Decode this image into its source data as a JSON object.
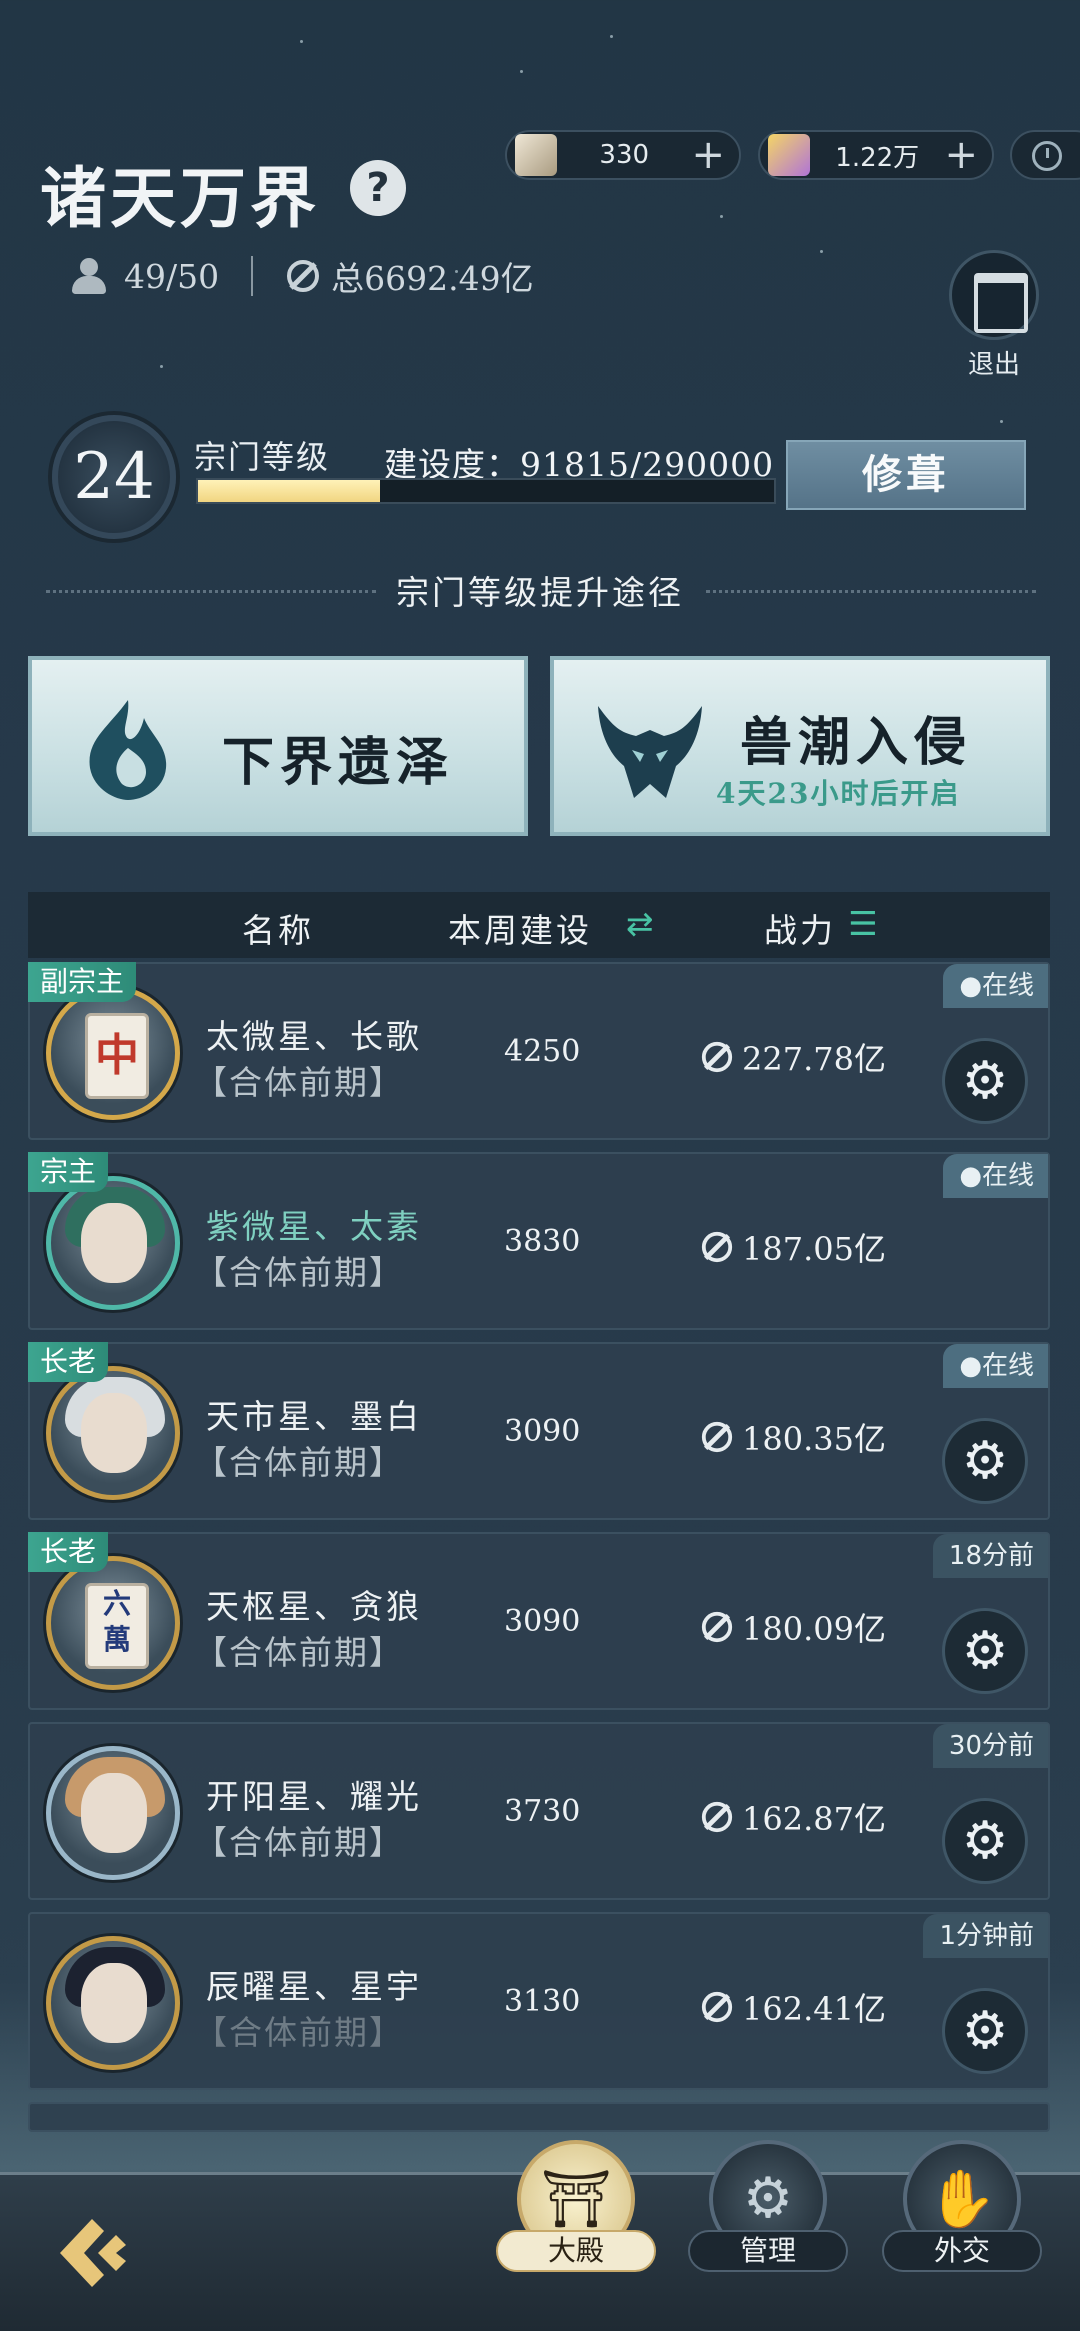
{
  "header": {
    "title": "诸天万界",
    "members": "49/50",
    "total_power": "总6692.49亿"
  },
  "resources": {
    "item1_value": "330",
    "item2_value": "1.22万"
  },
  "exit": {
    "label": "退出"
  },
  "level": {
    "value": "24",
    "label": "宗门等级",
    "build_text": "建设度：91815/290000",
    "progress_fraction": 0.3166,
    "upgrade_label": "修葺"
  },
  "routes": {
    "title": "宗门等级提升途径",
    "cards": [
      {
        "name": "下界遗泽",
        "sub": ""
      },
      {
        "name": "兽潮入侵",
        "sub": "4天23小时后开启"
      }
    ]
  },
  "table": {
    "col_name": "名称",
    "col_week": "本周建设",
    "col_power": "战力"
  },
  "members": [
    {
      "rank": "副宗主",
      "name": "太微星、长歌",
      "realm": "【合体前期】",
      "week": "4250",
      "power": "227.78亿",
      "status": "●在线",
      "online": true,
      "gear": true
    },
    {
      "rank": "宗主",
      "name": "紫微星、太素",
      "realm": "【合体前期】",
      "week": "3830",
      "power": "187.05亿",
      "status": "●在线",
      "online": true,
      "gear": false
    },
    {
      "rank": "长老",
      "name": "天市星、墨白",
      "realm": "【合体前期】",
      "week": "3090",
      "power": "180.35亿",
      "status": "●在线",
      "online": true,
      "gear": true
    },
    {
      "rank": "长老",
      "name": "天枢星、贪狼",
      "realm": "【合体前期】",
      "week": "3090",
      "power": "180.09亿",
      "status": "18分前",
      "online": false,
      "gear": true
    },
    {
      "rank": "",
      "name": "开阳星、耀光",
      "realm": "【合体前期】",
      "week": "3730",
      "power": "162.87亿",
      "status": "30分前",
      "online": false,
      "gear": true
    },
    {
      "rank": "",
      "name": "辰曜星、星宇",
      "realm": "【合体前期】",
      "week": "3130",
      "power": "162.41亿",
      "status": "1分钟前",
      "online": false,
      "gear": true
    }
  ],
  "nav": {
    "hall": "大殿",
    "manage": "管理",
    "diplomacy": "外交"
  },
  "colors": {
    "accent_teal": "#3da590",
    "progress_gold": "#f1d581",
    "background": "#26394a"
  }
}
